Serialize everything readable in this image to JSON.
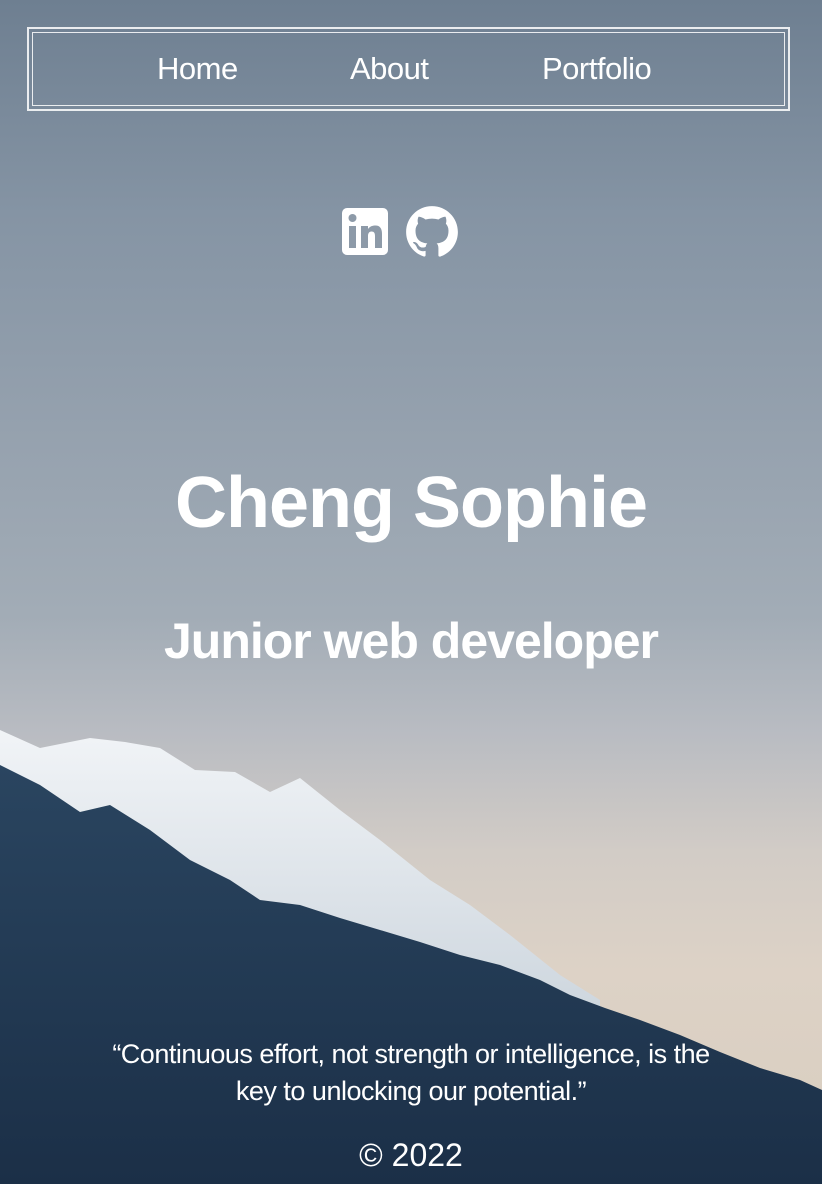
{
  "nav": {
    "items": [
      {
        "label": "Home"
      },
      {
        "label": "About"
      },
      {
        "label": "Portfolio"
      }
    ]
  },
  "social": {
    "icons": [
      "linkedin-icon",
      "github-icon"
    ]
  },
  "hero": {
    "name": "Cheng Sophie",
    "role": "Junior web developer"
  },
  "footer": {
    "quote": "“Continuous effort, not strength or intelligence, is the key to unlocking our potential.”",
    "copyright": "© 2022"
  },
  "colors": {
    "text": "#ffffff",
    "sky": "#8594a4",
    "forest": "#1f3650"
  }
}
